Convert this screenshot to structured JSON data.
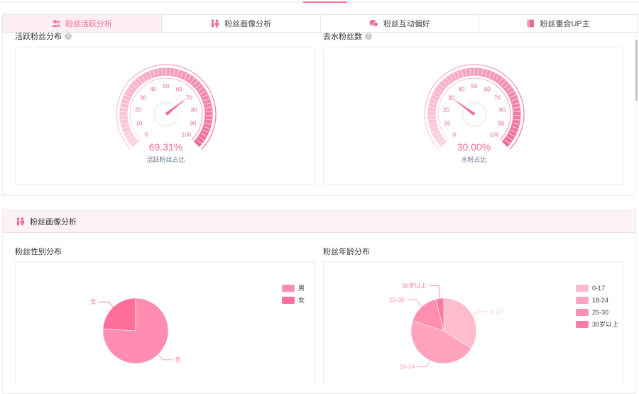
{
  "tabs": [
    {
      "label": "粉丝活跃分析",
      "icon": "users-icon",
      "active": true
    },
    {
      "label": "粉丝画像分析",
      "icon": "people-icon",
      "active": false
    },
    {
      "label": "粉丝互动偏好",
      "icon": "chat-icon",
      "active": false
    },
    {
      "label": "粉丝重合UP主",
      "icon": "book-icon",
      "active": false
    }
  ],
  "activity": {
    "left": {
      "title": "活跃粉丝分布",
      "value_text": "69.31%",
      "caption": "活跃粉丝占比"
    },
    "right": {
      "title": "去水粉丝数",
      "value_text": "30.00%",
      "caption": "水粉占比"
    }
  },
  "portrait": {
    "header": "粉丝画像分析",
    "gender_title": "粉丝性别分布",
    "age_title": "粉丝年龄分布"
  },
  "colors": {
    "accent": "#f26d98",
    "gauge_dark": "#f06b94",
    "gauge_light": "#fcd3e0"
  },
  "chart_data": [
    {
      "type": "gauge",
      "min": 0,
      "max": 100,
      "ticks": [
        "0",
        "10",
        "20",
        "30",
        "40",
        "50",
        "60",
        "70",
        "80",
        "90",
        "100"
      ],
      "value": 69.31,
      "label": "活跃粉丝占比"
    },
    {
      "type": "gauge",
      "min": 0,
      "max": 100,
      "ticks": [
        "0",
        "10",
        "20",
        "30",
        "40",
        "50",
        "60",
        "70",
        "80",
        "90",
        "100"
      ],
      "value": 30.0,
      "label": "水粉占比"
    },
    {
      "type": "pie",
      "title": "粉丝性别分布",
      "categories": [
        "男",
        "女"
      ],
      "values": [
        76,
        24
      ],
      "colors": [
        "#ff8db2",
        "#ff6e9b"
      ],
      "legend": "right"
    },
    {
      "type": "pie",
      "title": "粉丝年龄分布",
      "categories": [
        "0-17",
        "18-24",
        "25-30",
        "30岁以上"
      ],
      "values": [
        34,
        46,
        16,
        4
      ],
      "colors": [
        "#ffbccd",
        "#ffa3be",
        "#ff8fb1",
        "#ff7aa3"
      ],
      "legend": "right"
    }
  ]
}
